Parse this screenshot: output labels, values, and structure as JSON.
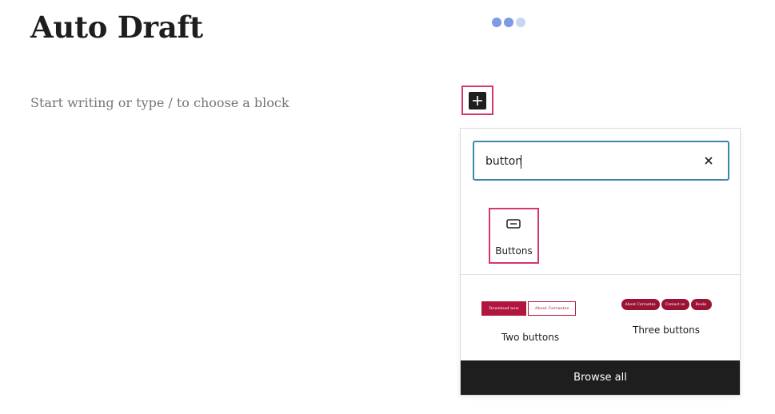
{
  "editor": {
    "title": "Auto Draft",
    "placeholder": "Start writing or type / to choose a block"
  },
  "loader": {
    "dot_colors": [
      "#7b9be4",
      "#7b9be4",
      "#c9d6f2"
    ]
  },
  "inserter": {
    "toggle_icon": "plus-icon",
    "search": {
      "value": "button",
      "clear_icon": "close-icon"
    },
    "blocks": [
      {
        "label": "Buttons",
        "icon": "buttons-icon"
      }
    ],
    "patterns": [
      {
        "label": "Two buttons",
        "buttons": [
          "Download now",
          "About Cervantes"
        ]
      },
      {
        "label": "Three buttons",
        "buttons": [
          "About Cervantes",
          "Contact us",
          "Books"
        ]
      }
    ],
    "browse_all_label": "Browse all"
  },
  "colors": {
    "highlight": "#d63865",
    "accent": "#3a87ad",
    "button_brand": "#b0163e",
    "dark": "#1e1e1e"
  }
}
